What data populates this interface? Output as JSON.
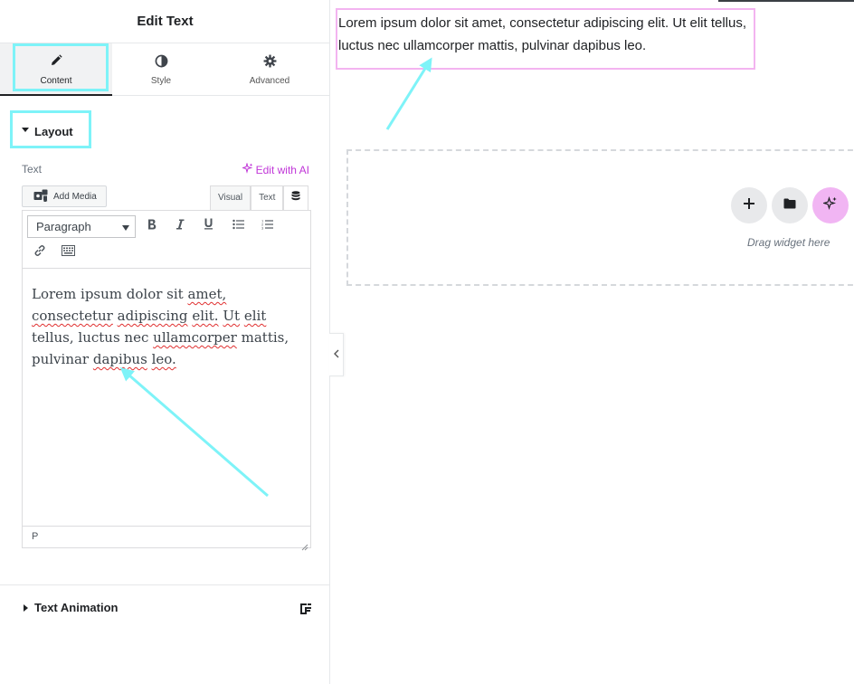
{
  "panel": {
    "title": "Edit Text",
    "tabs": [
      {
        "label": "Content",
        "icon": "pencil-icon"
      },
      {
        "label": "Style",
        "icon": "half-circle-icon"
      },
      {
        "label": "Advanced",
        "icon": "gear-icon"
      }
    ],
    "layout_section": "Layout",
    "field_label": "Text",
    "edit_with_ai": "Edit with AI",
    "add_media": "Add Media",
    "editor_tabs": {
      "visual": "Visual",
      "text": "Text"
    },
    "format_select": "Paragraph",
    "toolbar_buttons": [
      "bold",
      "italic",
      "underline",
      "bullet-list",
      "numbered-list",
      "link",
      "toolbar-toggle"
    ],
    "editor_content": {
      "w1": "Lorem ipsum dolor sit",
      "w2": "amet,",
      "w3": "consectetur",
      "w4": "adipiscing",
      "w5": "elit.",
      "w6": "Ut",
      "w7": "elit",
      "w8": "tellus, luctus",
      "w9": "nec",
      "w10": "ullamcorper",
      "w11": "mattis, pulvinar",
      "w12": "dapibus",
      "w13": "leo."
    },
    "status_path": "P",
    "animation_section": "Text Animation"
  },
  "canvas": {
    "text_widget": "Lorem ipsum dolor sit amet, consectetur adipiscing elit. Ut elit tellus, luctus nec ullamcorper mattis, pulvinar dapibus leo.",
    "drag_hint": "Drag widget here"
  },
  "colors": {
    "highlight": "#7ef3f8",
    "ai_accent": "#c036d8",
    "widget_border": "#f3b4f0",
    "ai_button": "#f1b5f3"
  }
}
